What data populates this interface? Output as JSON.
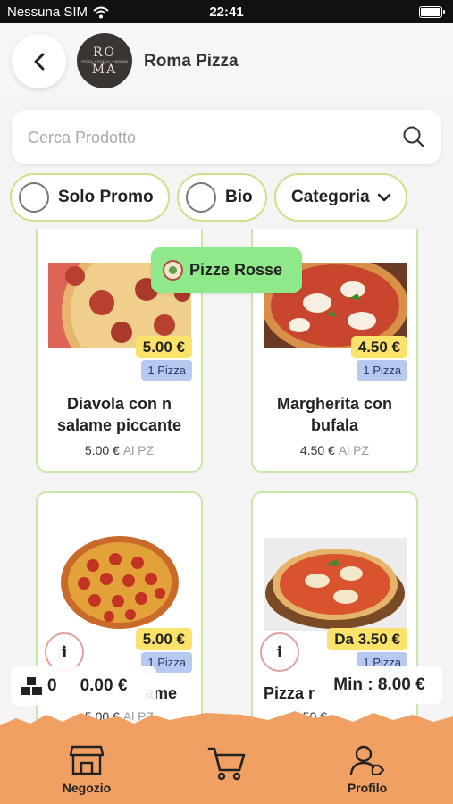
{
  "status_bar": {
    "carrier": "Nessuna SIM",
    "time": "22:41"
  },
  "header": {
    "store_name": "Roma Pizza",
    "logo_top": "RO",
    "logo_bottom": "MA",
    "logo_sub": "PIZZA • POLLO • KEBAB"
  },
  "search": {
    "placeholder": "Cerca Prodotto",
    "value": ""
  },
  "filters": {
    "promo": "Solo Promo",
    "bio": "Bio",
    "category": "Categoria"
  },
  "category_badge": "Pizze Rosse",
  "products": [
    {
      "name_line1": "Diavola con n",
      "name_line2": "salame piccante",
      "price": "5.00 €",
      "unit": "1 Pizza",
      "unit_price": "5.00 €",
      "unit_label": "Al PZ"
    },
    {
      "name_line1": "Margherita con",
      "name_line2": "bufala",
      "price": "4.50 €",
      "unit": "1 Pizza",
      "unit_price": "4.50 €",
      "unit_label": "Al PZ"
    },
    {
      "name_line1": "ame",
      "price": "5.00 €",
      "unit": "1 Pizza",
      "unit_price": "5.00 €",
      "unit_label": "Al PZ"
    },
    {
      "name_line1": "Pizza r",
      "price": "Da 3.50 €",
      "unit": "1 Pizza",
      "unit_price": "3.50 €"
    }
  ],
  "cart": {
    "count": "0",
    "total": "0.00 €",
    "min_order": "Min : 8.00 €"
  },
  "nav": {
    "shop": "Negozio",
    "profile": "Profilo"
  },
  "colors": {
    "accent_green": "#8fe98a",
    "chip_border": "#c9e28e",
    "price_yellow": "#fbe26a",
    "unit_blue": "#b7c9ee",
    "nav_orange": "#f0a062"
  }
}
